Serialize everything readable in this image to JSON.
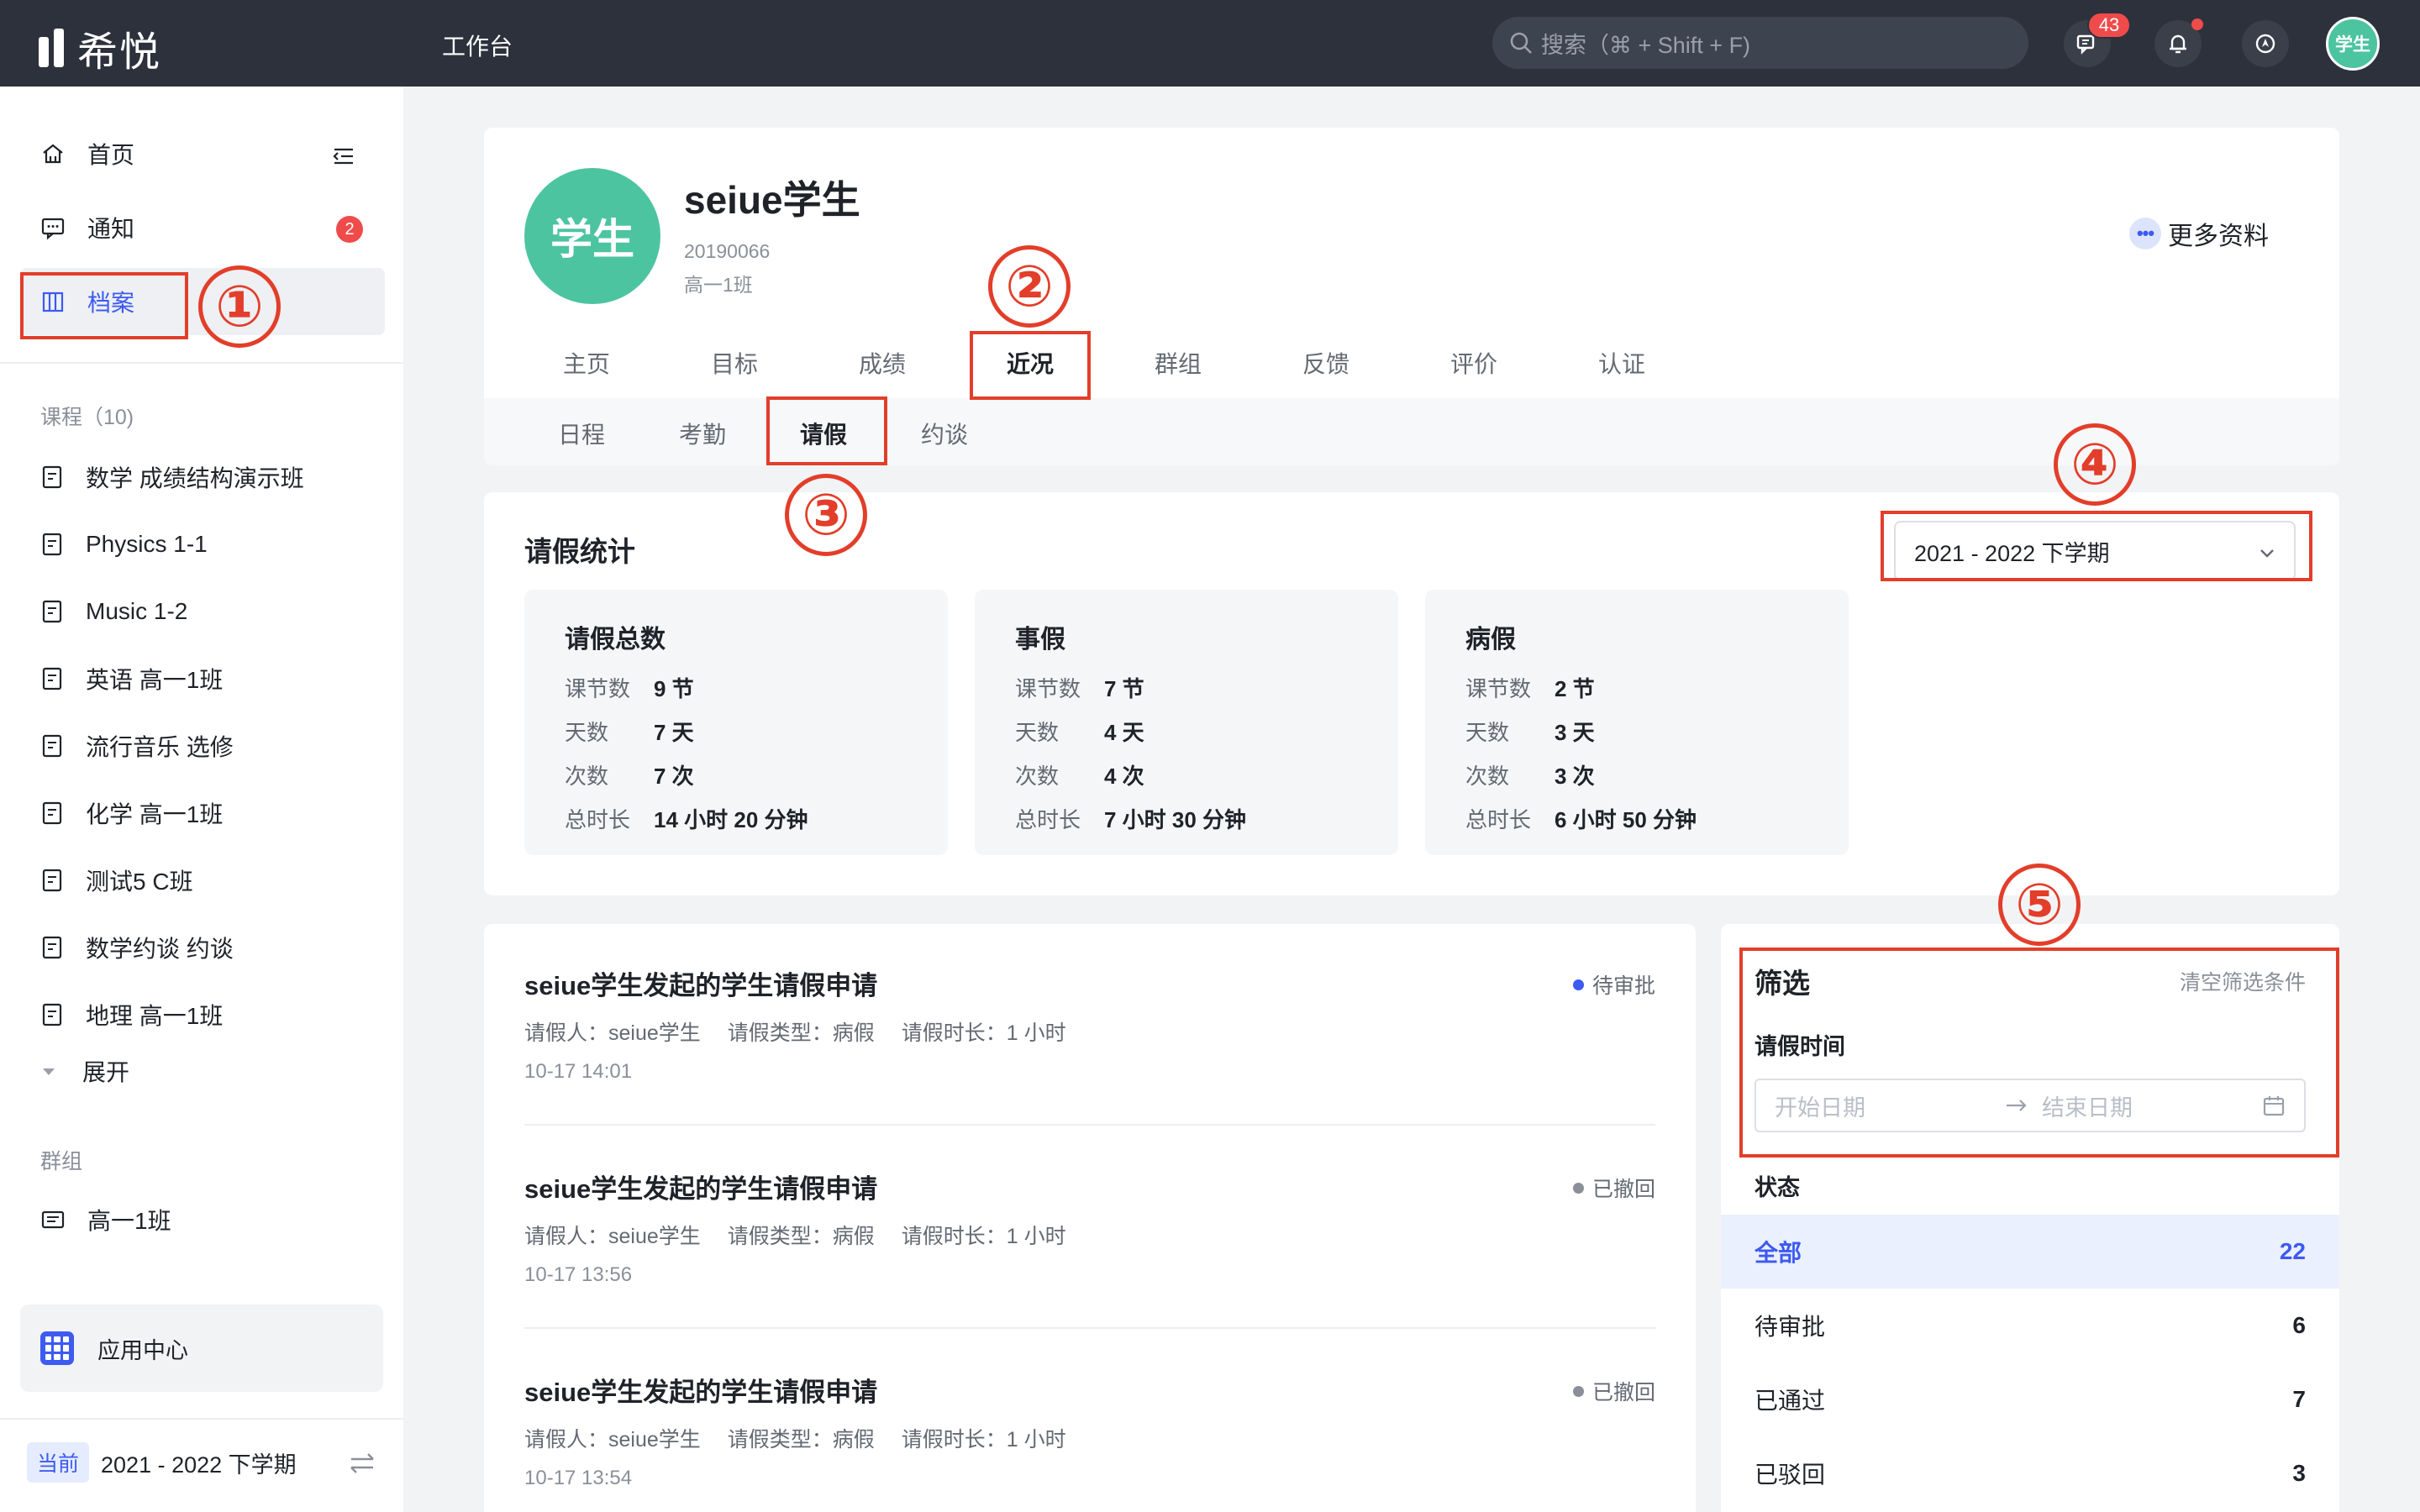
{
  "app": {
    "name": "希悦",
    "workbench": "工作台"
  },
  "search": {
    "placeholder": "搜索（⌘ + Shift + F)"
  },
  "header": {
    "message_count": "43",
    "avatar_label": "学生"
  },
  "sidebar": {
    "home": "首页",
    "notice": "通知",
    "notice_badge": "2",
    "archive": "档案",
    "courses_label": "课程（10)",
    "courses": [
      "数学 成绩结构演示班",
      "Physics 1-1",
      "Music 1-2",
      "英语 高一1班",
      "流行音乐 选修",
      "化学 高一1班",
      "测试5 C班",
      "数学约谈 约谈",
      "地理 高一1班"
    ],
    "expand": "展开",
    "groups_label": "群组",
    "groups": [
      "高一1班"
    ],
    "app_center": "应用中心",
    "current_tag": "当前",
    "current_term": "2021 - 2022 下学期"
  },
  "profile": {
    "avatar_label": "学生",
    "name": "seiue学生",
    "student_id": "20190066",
    "class": "高一1班",
    "more": "更多资料",
    "tabs": [
      "主页",
      "目标",
      "成绩",
      "近况",
      "群组",
      "反馈",
      "评价",
      "认证"
    ],
    "active_tab": "近况",
    "subtabs": [
      "日程",
      "考勤",
      "请假",
      "约谈"
    ],
    "active_subtab": "请假"
  },
  "stats": {
    "title": "请假统计",
    "term": "2021 - 2022 下学期",
    "boxes": [
      {
        "title": "请假总数",
        "rows": [
          {
            "k": "课节数",
            "v": "9 节"
          },
          {
            "k": "天数",
            "v": "7 天"
          },
          {
            "k": "次数",
            "v": "7 次"
          },
          {
            "k": "总时长",
            "v": "14 小时 20 分钟"
          }
        ]
      },
      {
        "title": "事假",
        "rows": [
          {
            "k": "课节数",
            "v": "7 节"
          },
          {
            "k": "天数",
            "v": "4 天"
          },
          {
            "k": "次数",
            "v": "4 次"
          },
          {
            "k": "总时长",
            "v": "7 小时 30 分钟"
          }
        ]
      },
      {
        "title": "病假",
        "rows": [
          {
            "k": "课节数",
            "v": "2 节"
          },
          {
            "k": "天数",
            "v": "3 天"
          },
          {
            "k": "次数",
            "v": "3 次"
          },
          {
            "k": "总时长",
            "v": "6 小时 50 分钟"
          }
        ]
      }
    ]
  },
  "leaves": [
    {
      "title": "seiue学生发起的学生请假申请",
      "status": "待审批",
      "status_color": "#3d5af1",
      "applicant": "请假人：seiue学生",
      "type": "请假类型：病假",
      "duration": "请假时长：1 小时",
      "time": "10-17 14:01"
    },
    {
      "title": "seiue学生发起的学生请假申请",
      "status": "已撤回",
      "status_color": "#8a8f99",
      "applicant": "请假人：seiue学生",
      "type": "请假类型：病假",
      "duration": "请假时长：1 小时",
      "time": "10-17 13:56"
    },
    {
      "title": "seiue学生发起的学生请假申请",
      "status": "已撤回",
      "status_color": "#8a8f99",
      "applicant": "请假人：seiue学生",
      "type": "请假类型：病假",
      "duration": "请假时长：1 小时",
      "time": "10-17 13:54"
    }
  ],
  "filter": {
    "title": "筛选",
    "clear": "清空筛选条件",
    "time_label": "请假时间",
    "start_placeholder": "开始日期",
    "end_placeholder": "结束日期",
    "status_label": "状态",
    "options": [
      {
        "label": "全部",
        "count": "22"
      },
      {
        "label": "待审批",
        "count": "6"
      },
      {
        "label": "已通过",
        "count": "7"
      },
      {
        "label": "已驳回",
        "count": "3"
      }
    ]
  },
  "annotations": [
    "①",
    "②",
    "③",
    "④",
    "⑤"
  ],
  "colors": {
    "topbar": "#2c313c",
    "accent": "#3d5af1",
    "avatar": "#4cc49f",
    "annotation": "#e23e2a",
    "badge": "#f04b4b"
  }
}
